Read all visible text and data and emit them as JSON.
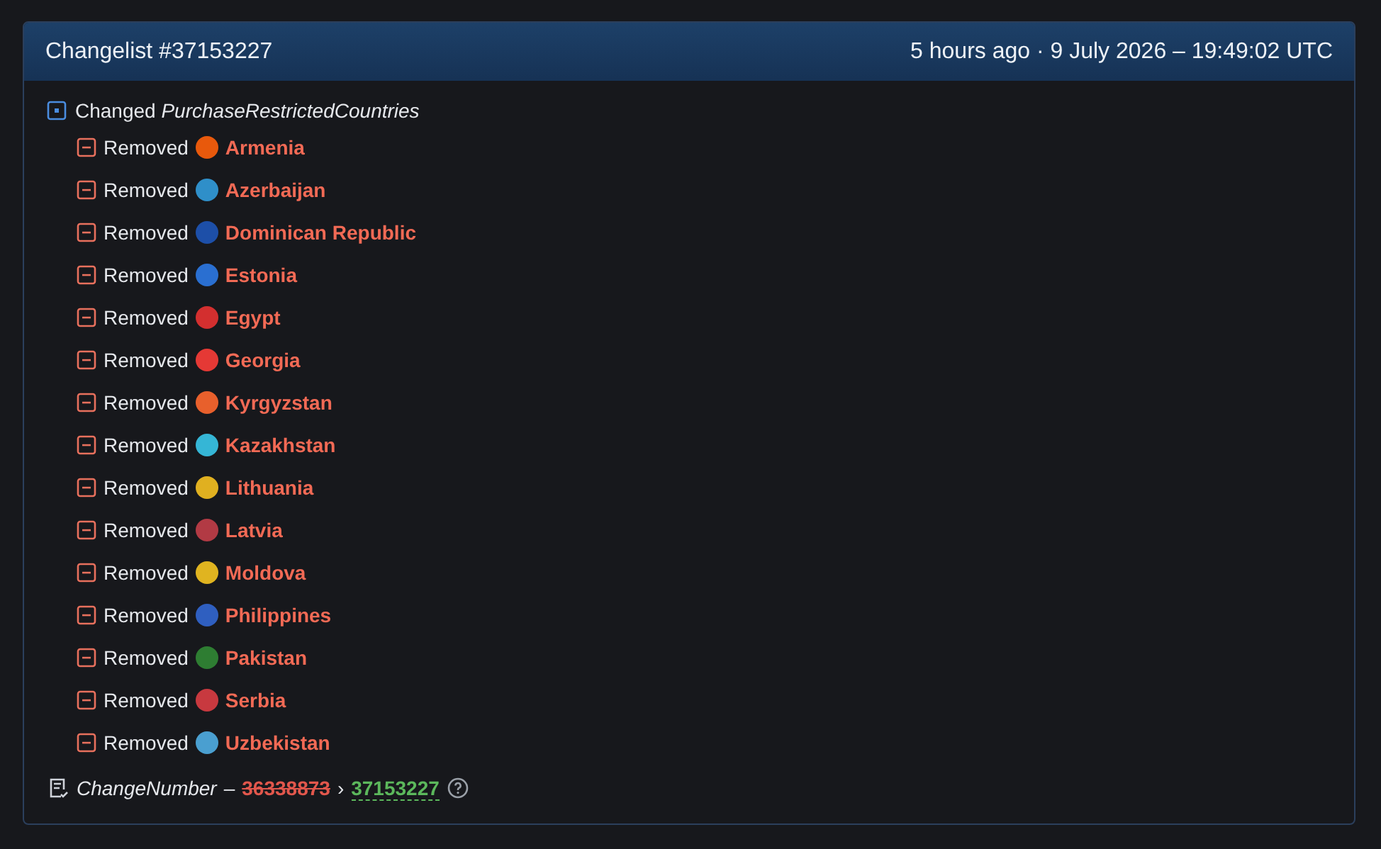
{
  "header": {
    "title": "Changelist #37153227",
    "time": "5 hours ago · 9 July 2026 – 19:49:02 UTC"
  },
  "change": {
    "action": "Changed",
    "key": "PurchaseRestrictedCountries",
    "items": [
      {
        "action": "Removed",
        "name": "Armenia",
        "color": "#e8590c"
      },
      {
        "action": "Removed",
        "name": "Azerbaijan",
        "color": "#2f8fc9"
      },
      {
        "action": "Removed",
        "name": "Dominican Republic",
        "color": "#1d4fa8"
      },
      {
        "action": "Removed",
        "name": "Estonia",
        "color": "#2a6fd1"
      },
      {
        "action": "Removed",
        "name": "Egypt",
        "color": "#d32f2f"
      },
      {
        "action": "Removed",
        "name": "Georgia",
        "color": "#e53935"
      },
      {
        "action": "Removed",
        "name": "Kyrgyzstan",
        "color": "#e8602c"
      },
      {
        "action": "Removed",
        "name": "Kazakhstan",
        "color": "#35b6d6"
      },
      {
        "action": "Removed",
        "name": "Lithuania",
        "color": "#e0b020"
      },
      {
        "action": "Removed",
        "name": "Latvia",
        "color": "#b23a44"
      },
      {
        "action": "Removed",
        "name": "Moldova",
        "color": "#e0b420"
      },
      {
        "action": "Removed",
        "name": "Philippines",
        "color": "#2f5fc0"
      },
      {
        "action": "Removed",
        "name": "Pakistan",
        "color": "#2e7d32"
      },
      {
        "action": "Removed",
        "name": "Serbia",
        "color": "#c8393f"
      },
      {
        "action": "Removed",
        "name": "Uzbekistan",
        "color": "#4a9fd0"
      }
    ]
  },
  "footer": {
    "key": "ChangeNumber",
    "separator": "–",
    "old": "36338873",
    "arrow": "›",
    "new": "37153227"
  }
}
